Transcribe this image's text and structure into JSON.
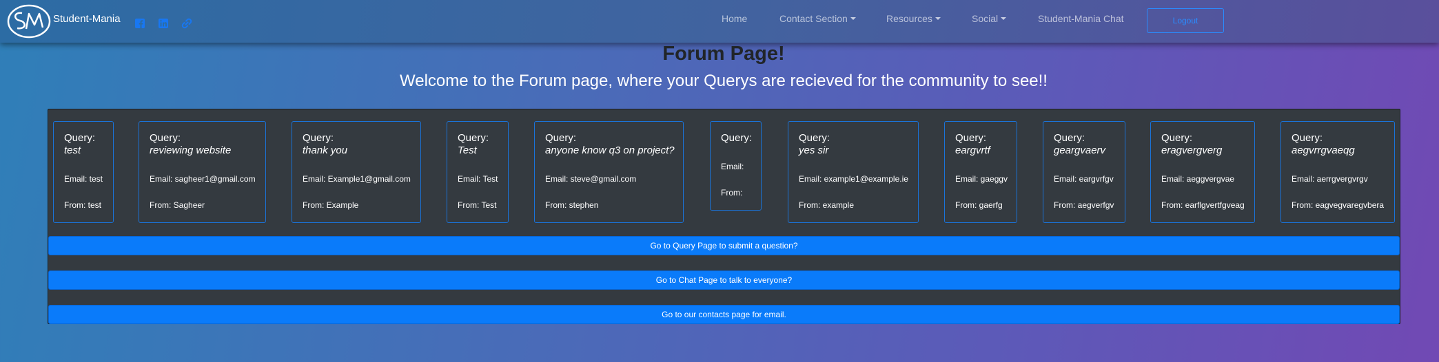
{
  "nav": {
    "brand": "Student-Mania",
    "items": [
      {
        "label": "Home",
        "dropdown": false
      },
      {
        "label": "Contact Section",
        "dropdown": true
      },
      {
        "label": "Resources",
        "dropdown": true
      },
      {
        "label": "Social",
        "dropdown": true
      },
      {
        "label": "Student-Mania Chat",
        "dropdown": false
      }
    ],
    "logout": "Logout",
    "social_icons": [
      "facebook-icon",
      "linkedin-icon",
      "link-icon"
    ]
  },
  "header": {
    "title": "Forum Page!",
    "subtitle": "Welcome to the Forum page, where your Querys are recieved for the community to see!!"
  },
  "queries": [
    {
      "label": "Query:",
      "title": "test",
      "email": "Email: test",
      "from": "From: test"
    },
    {
      "label": "Query:",
      "title": "reviewing website",
      "email": "Email: sagheer1@gmail.com",
      "from": "From: Sagheer"
    },
    {
      "label": "Query:",
      "title": "thank you",
      "email": "Email: Example1@gmail.com",
      "from": "From: Example"
    },
    {
      "label": "Query:",
      "title": "Test",
      "email": "Email: Test",
      "from": "From: Test"
    },
    {
      "label": "Query:",
      "title": "anyone know q3 on project?",
      "email": "Email: steve@gmail.com",
      "from": "From: stephen"
    },
    {
      "label": "Query:",
      "title": "",
      "email": "Email:",
      "from": "From:"
    },
    {
      "label": "Query:",
      "title": "yes sir",
      "email": "Email: example1@example.ie",
      "from": "From: example"
    },
    {
      "label": "Query:",
      "title": "eargvrtf",
      "email": "Email: gaeggv",
      "from": "From: gaerfg"
    },
    {
      "label": "Query:",
      "title": "geargvaerv",
      "email": "Email: eargvrfgv",
      "from": "From: aegverfgv"
    },
    {
      "label": "Query:",
      "title": "eragvergverg",
      "email": "Email: aeggvergvae",
      "from": "From: earflgvertfgveag"
    },
    {
      "label": "Query:",
      "title": "aegvrrgvaeqg",
      "email": "Email: aerrgvergvrgv",
      "from": "From: eagvegvaregvbera"
    }
  ],
  "buttons": {
    "query": "Go to Query Page to submit a question?",
    "chat": "Go to Chat Page to talk to everyone?",
    "contacts": "Go to our contacts page for email."
  },
  "colors": {
    "accent": "#0a7bfa",
    "panel": "#343a40",
    "card_border": "#1a73d9"
  }
}
